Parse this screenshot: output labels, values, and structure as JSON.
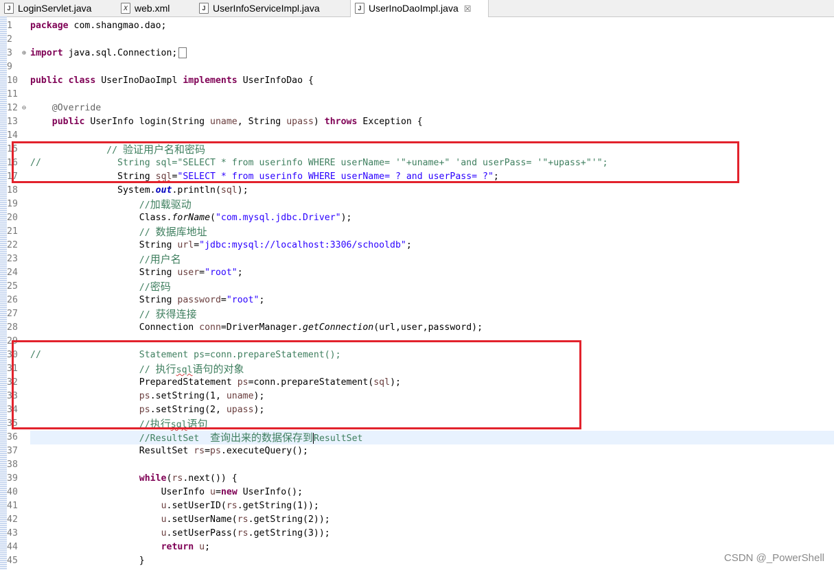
{
  "tabs": [
    {
      "label": "LoginServlet.java",
      "icon": "java-file-icon"
    },
    {
      "label": "web.xml",
      "icon": "xml-file-icon"
    },
    {
      "label": "UserInfoServiceImpl.java",
      "icon": "java-file-icon"
    },
    {
      "label": "UserInoDaoImpl.java",
      "icon": "java-file-icon",
      "active": true,
      "close": "☒"
    }
  ],
  "line_numbers": [
    "1",
    "2",
    "3",
    "9",
    "10",
    "11",
    "12",
    "13",
    "14",
    "15",
    "16",
    "17",
    "18",
    "19",
    "20",
    "21",
    "22",
    "23",
    "24",
    "25",
    "26",
    "27",
    "28",
    "29",
    "30",
    "31",
    "32",
    "33",
    "34",
    "35",
    "36",
    "37",
    "38",
    "39",
    "40",
    "41",
    "42",
    "43",
    "44",
    "45"
  ],
  "code": {
    "l1": {
      "kw": "package",
      "rest": " com.shangmao.dao;"
    },
    "l3": {
      "kw": "import",
      "rest": " java.sql.Connection;"
    },
    "l10": {
      "kw1": "public",
      "kw2": "class",
      "name": " UserInoDaoImpl ",
      "kw3": "implements",
      "rest": " UserInfoDao {"
    },
    "l12": {
      "ann": "@Override"
    },
    "l13": {
      "kw1": "public",
      "a": " UserInfo login(String ",
      "p1": "uname",
      ", b": "",
      "b": ", String ",
      "p2": "upass",
      "c": ") ",
      "kw2": "throws",
      "d": " Exception {"
    },
    "l15": {
      "cmt": "// ",
      "cn": "验证用户名和密码"
    },
    "l16": {
      "cmt": "//              String sql=\"SELECT * from userinfo WHERE userName= '\"+uname+\" 'and userPass= '\"+upass+\"'\";"
    },
    "l17": {
      "a": "String ",
      "v": "sql",
      "b": "=",
      "s": "\"SELECT * from userinfo WHERE userName= ? and userPass= ?\"",
      "c": ";"
    },
    "l18": {
      "a": "System.",
      "f": "out",
      "b": ".println(",
      "v": "sql",
      "c": ");"
    },
    "l19": {
      "cmt": "//",
      "cn": "加载驱动"
    },
    "l20": {
      "a": "Class.",
      "m": "forName",
      "b": "(",
      "s": "\"com.mysql.jdbc.Driver\"",
      "c": ");"
    },
    "l21": {
      "cmt": "// ",
      "cn": "数据库地址"
    },
    "l22": {
      "a": "String ",
      "v": "url",
      "b": "=",
      "s": "\"jdbc:mysql://localhost:3306/schooldb\"",
      "c": ";"
    },
    "l23": {
      "cmt": "//",
      "cn": "用户名"
    },
    "l24": {
      "a": "String ",
      "v": "user",
      "b": "=",
      "s": "\"root\"",
      "c": ";"
    },
    "l25": {
      "cmt": "//",
      "cn": "密码"
    },
    "l26": {
      "a": "String ",
      "v": "password",
      "b": "=",
      "s": "\"root\"",
      "c": ";"
    },
    "l27": {
      "cmt": "// ",
      "cn": "获得连接"
    },
    "l28": {
      "a": "Connection ",
      "v": "conn",
      "b": "=DriverManager.",
      "m": "getConnection",
      "c": "(url,user,password);"
    },
    "l30": {
      "cmt": "//                  Statement ps=conn.prepareStatement();"
    },
    "l31": {
      "cmt": "// ",
      "cn": "执行",
      "cmt2": "sql",
      "cn2": "语句的对象"
    },
    "l32": {
      "a": "PreparedStatement ",
      "v": "ps",
      "b": "=conn.prepareStatement(",
      "v2": "sql",
      "c": ");"
    },
    "l33": {
      "v": "ps",
      "a": ".setString(1, ",
      "v2": "uname",
      "c": ");"
    },
    "l34": {
      "v": "ps",
      "a": ".setString(2, ",
      "v2": "upass",
      "c": ");"
    },
    "l35": {
      "cmt": "//",
      "cn": "执行",
      "cmt2": "sql",
      "cn2": "语句"
    },
    "l36": {
      "cmt": "//ResultSet  ",
      "cn": "查询出来的数据保存到",
      "cmt2": "ResultSet"
    },
    "l37": {
      "a": "ResultSet ",
      "v": "rs",
      "b": "=",
      "v2": "ps",
      "c": ".executeQuery();"
    },
    "l39": {
      "kw": "while",
      "a": "(",
      "v": "rs",
      "b": ".next()) {"
    },
    "l40": {
      "a": "UserInfo ",
      "v": "u",
      "b": "=",
      "kw": "new",
      "c": " UserInfo();"
    },
    "l41": {
      "v": "u",
      "a": ".setUserID(",
      "v2": "rs",
      "b": ".getString(1));"
    },
    "l42": {
      "v": "u",
      "a": ".setUserName(",
      "v2": "rs",
      "b": ".getString(2));"
    },
    "l43": {
      "v": "u",
      "a": ".setUserPass(",
      "v2": "rs",
      "b": ".getString(3));"
    },
    "l44": {
      "kw": "return",
      "a": " ",
      "v": "u",
      "b": ";"
    },
    "l45": {
      "a": "}"
    }
  },
  "watermark": "CSDN @_PowerShell",
  "colors": {
    "keyword": "#7f0055",
    "string": "#2a00ff",
    "comment": "#3f7f5f",
    "variable": "#6a3e3e",
    "highlight_box": "#e2222c",
    "current_line": "#e8f2fe"
  }
}
